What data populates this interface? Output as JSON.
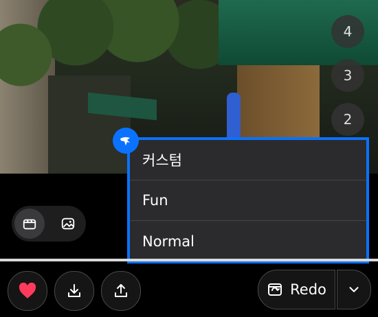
{
  "image_numbers": [
    "4",
    "3",
    "2"
  ],
  "menu": {
    "items": [
      {
        "label": "커스텀"
      },
      {
        "label": "Fun"
      },
      {
        "label": "Normal"
      }
    ]
  },
  "toolbar": {
    "redo_label": "Redo"
  },
  "colors": {
    "accent": "#0a72ff",
    "heart": "#ff3b5c"
  }
}
